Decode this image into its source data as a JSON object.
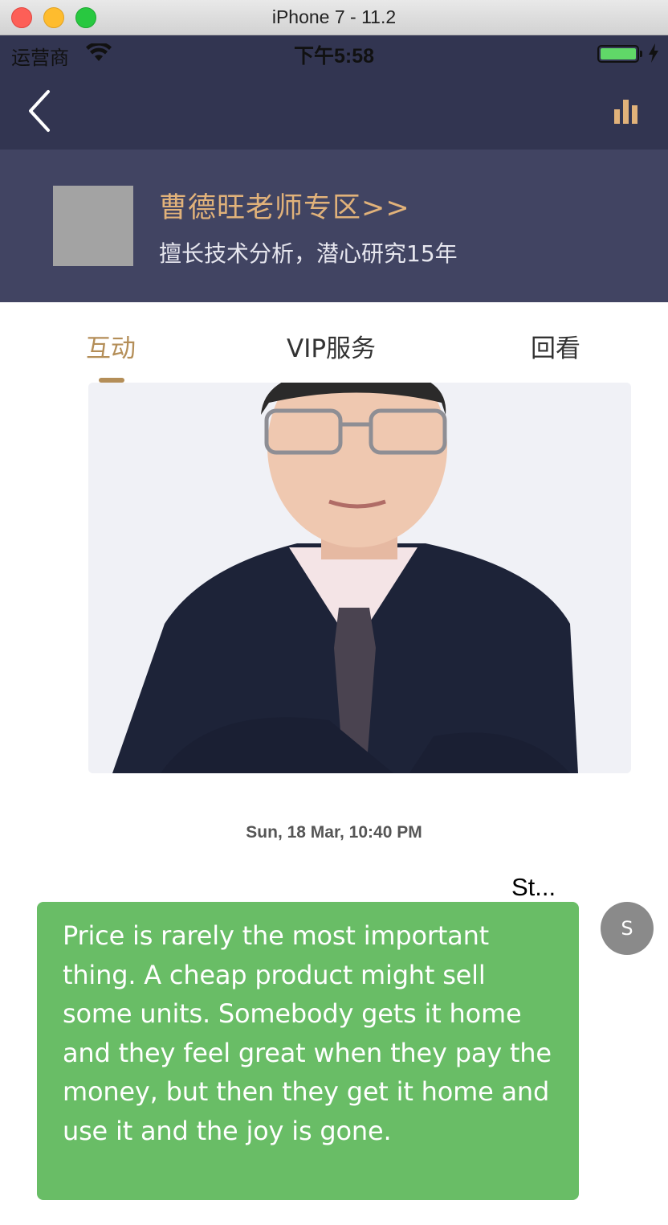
{
  "window": {
    "title": "iPhone 7 - 11.2"
  },
  "status_bar": {
    "carrier": "运营商",
    "time": "下午5:58",
    "battery_level": 1.0
  },
  "nav": {
    "back_icon": "chevron-left-icon",
    "stats_icon": "bar-chart-icon"
  },
  "teacher": {
    "name": "曹德旺老师专区>>",
    "description": "擅长技术分析，潜心研究15年"
  },
  "tabs": [
    {
      "label": "互动",
      "active": true
    },
    {
      "label": "VIP服务",
      "active": false
    },
    {
      "label": "回看",
      "active": false
    }
  ],
  "chat": {
    "timestamp": "Sun, 18 Mar, 10:40 PM",
    "sender_name": "St...",
    "sender_avatar_initial": "S",
    "message": "Price is rarely the most important thing. A cheap product might sell some units. Somebody gets it home and they feel great when they pay the money, but then they get it home and use it and the joy is gone."
  },
  "colors": {
    "nav_bg": "#323551",
    "header_bg": "#414462",
    "accent_gold": "#b48e58",
    "bubble_green": "#69bd66"
  }
}
